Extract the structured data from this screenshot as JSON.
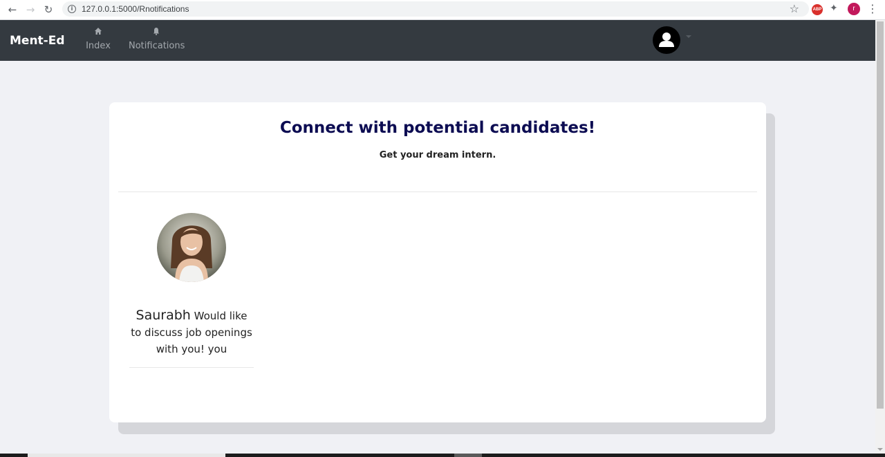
{
  "browser": {
    "url": "127.0.0.1:5000/Rnotifications",
    "profile_initial": "r",
    "extension_label": "ABP",
    "icons": [
      "back-icon",
      "forward-icon",
      "reload-icon",
      "info-icon",
      "star-icon",
      "adblock-icon",
      "puzzle-icon",
      "profile-icon",
      "kebab-menu-icon"
    ]
  },
  "navbar": {
    "brand": "Ment-Ed",
    "links": [
      {
        "label": "Index",
        "icon": "home-icon"
      },
      {
        "label": "Notifications",
        "icon": "bell-icon"
      }
    ],
    "user_icon": "user-avatar-icon"
  },
  "card": {
    "title": "Connect with potential candidates!",
    "subtitle": "Get your dream intern.",
    "notifications": [
      {
        "name": "Saurabh",
        "message": "Would like to discuss job openings with you! you"
      }
    ]
  },
  "colors": {
    "navbar_bg": "#343a40",
    "page_bg": "#f0f1f5",
    "title_color": "#0c0c52"
  }
}
